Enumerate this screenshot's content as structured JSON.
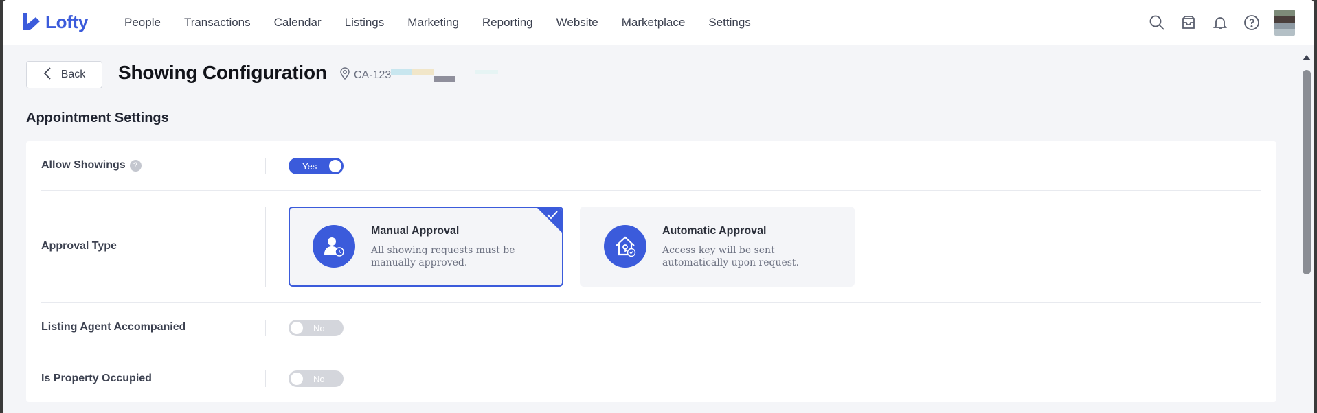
{
  "brand": {
    "name": "Lofty",
    "accent": "#3b5bdb"
  },
  "nav": {
    "items": [
      "People",
      "Transactions",
      "Calendar",
      "Listings",
      "Marketing",
      "Reporting",
      "Website",
      "Marketplace",
      "Settings"
    ],
    "icons": [
      "search-icon",
      "inbox-icon",
      "bell-icon",
      "help-icon"
    ]
  },
  "header": {
    "back_label": "Back",
    "title": "Showing Configuration",
    "listing_id": "CA-123"
  },
  "section": {
    "title": "Appointment Settings"
  },
  "settings": {
    "allow_showings": {
      "label": "Allow Showings",
      "value": "Yes",
      "on": true
    },
    "approval_type": {
      "label": "Approval Type",
      "options": [
        {
          "title": "Manual Approval",
          "desc": "All showing requests must be manually approved.",
          "selected": true
        },
        {
          "title": "Automatic Approval",
          "desc": "Access key will be sent automatically upon request.",
          "selected": false
        }
      ]
    },
    "listing_agent_accompanied": {
      "label": "Listing Agent Accompanied",
      "value": "No",
      "on": false
    },
    "is_property_occupied": {
      "label": "Is Property Occupied",
      "value": "No",
      "on": false
    }
  }
}
